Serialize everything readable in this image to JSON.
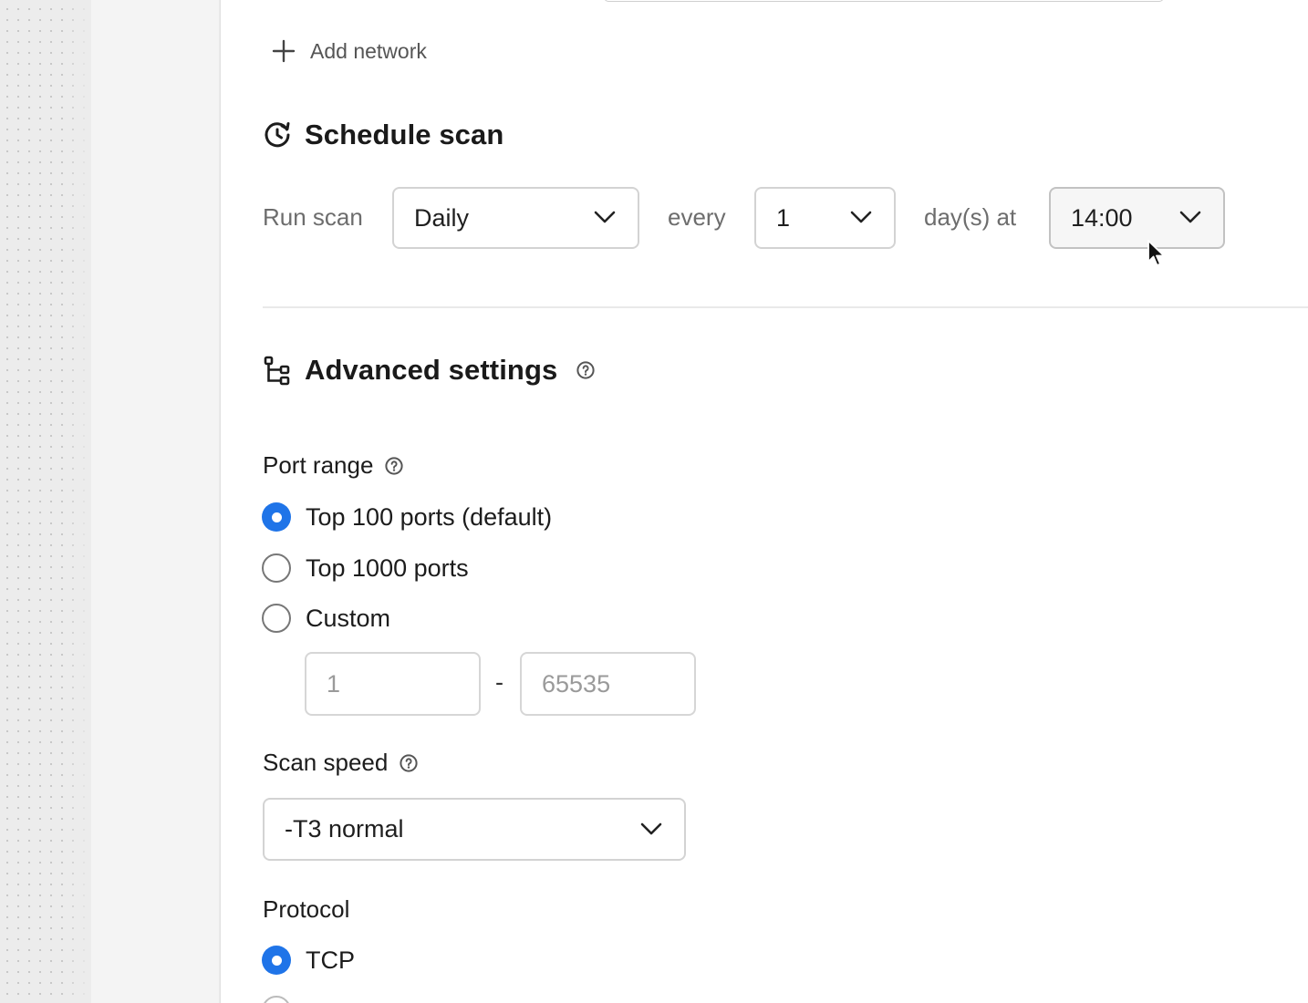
{
  "network": {
    "add_label": "Add network"
  },
  "schedule": {
    "title": "Schedule scan",
    "run_scan_label": "Run scan",
    "frequency_value": "Daily",
    "every_label": "every",
    "interval_value": "1",
    "days_at_label": "day(s) at",
    "time_value": "14:00"
  },
  "advanced": {
    "title": "Advanced settings",
    "port_range": {
      "label": "Port range",
      "options": [
        "Top 100 ports (default)",
        "Top 1000 ports",
        "Custom"
      ],
      "selected": "Top 100 ports (default)",
      "custom_from_placeholder": "1",
      "custom_separator": "-",
      "custom_to_placeholder": "65535"
    },
    "scan_speed": {
      "label": "Scan speed",
      "value": "-T3 normal"
    },
    "protocol": {
      "label": "Protocol",
      "options": [
        "TCP"
      ],
      "selected": "TCP"
    }
  },
  "colors": {
    "accent": "#1f74e8",
    "muted_text": "#6d6d6d",
    "border": "#d3d3d3"
  }
}
